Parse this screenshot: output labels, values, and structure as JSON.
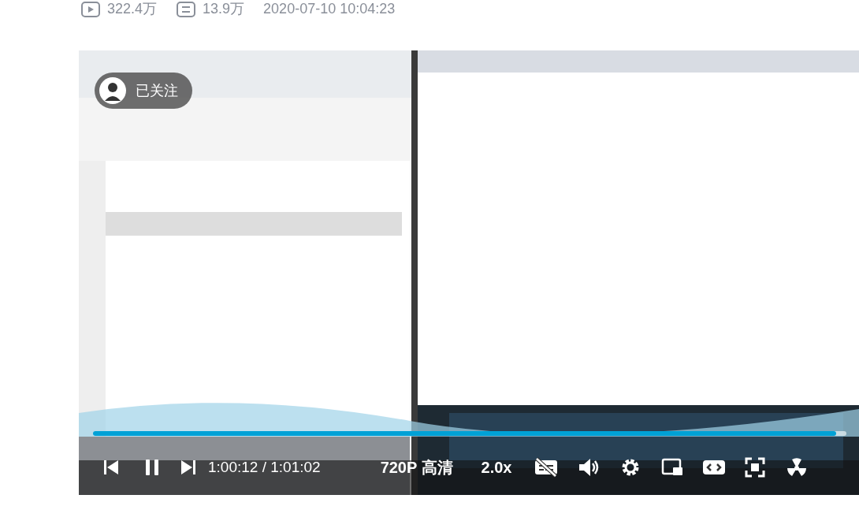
{
  "stats": {
    "views": "322.4万",
    "comments": "13.9万",
    "published": "2020-07-10 10:04:23"
  },
  "video": {
    "kind": "picture",
    "follow_button": {
      "label": "已关注"
    },
    "progress": {
      "level": 0.986
    },
    "controls": {
      "playing": true,
      "current_time": "1:00:12",
      "separator": "/",
      "duration": "1:01:02",
      "quality": "720P 高清",
      "speed": "2.0x"
    }
  }
}
